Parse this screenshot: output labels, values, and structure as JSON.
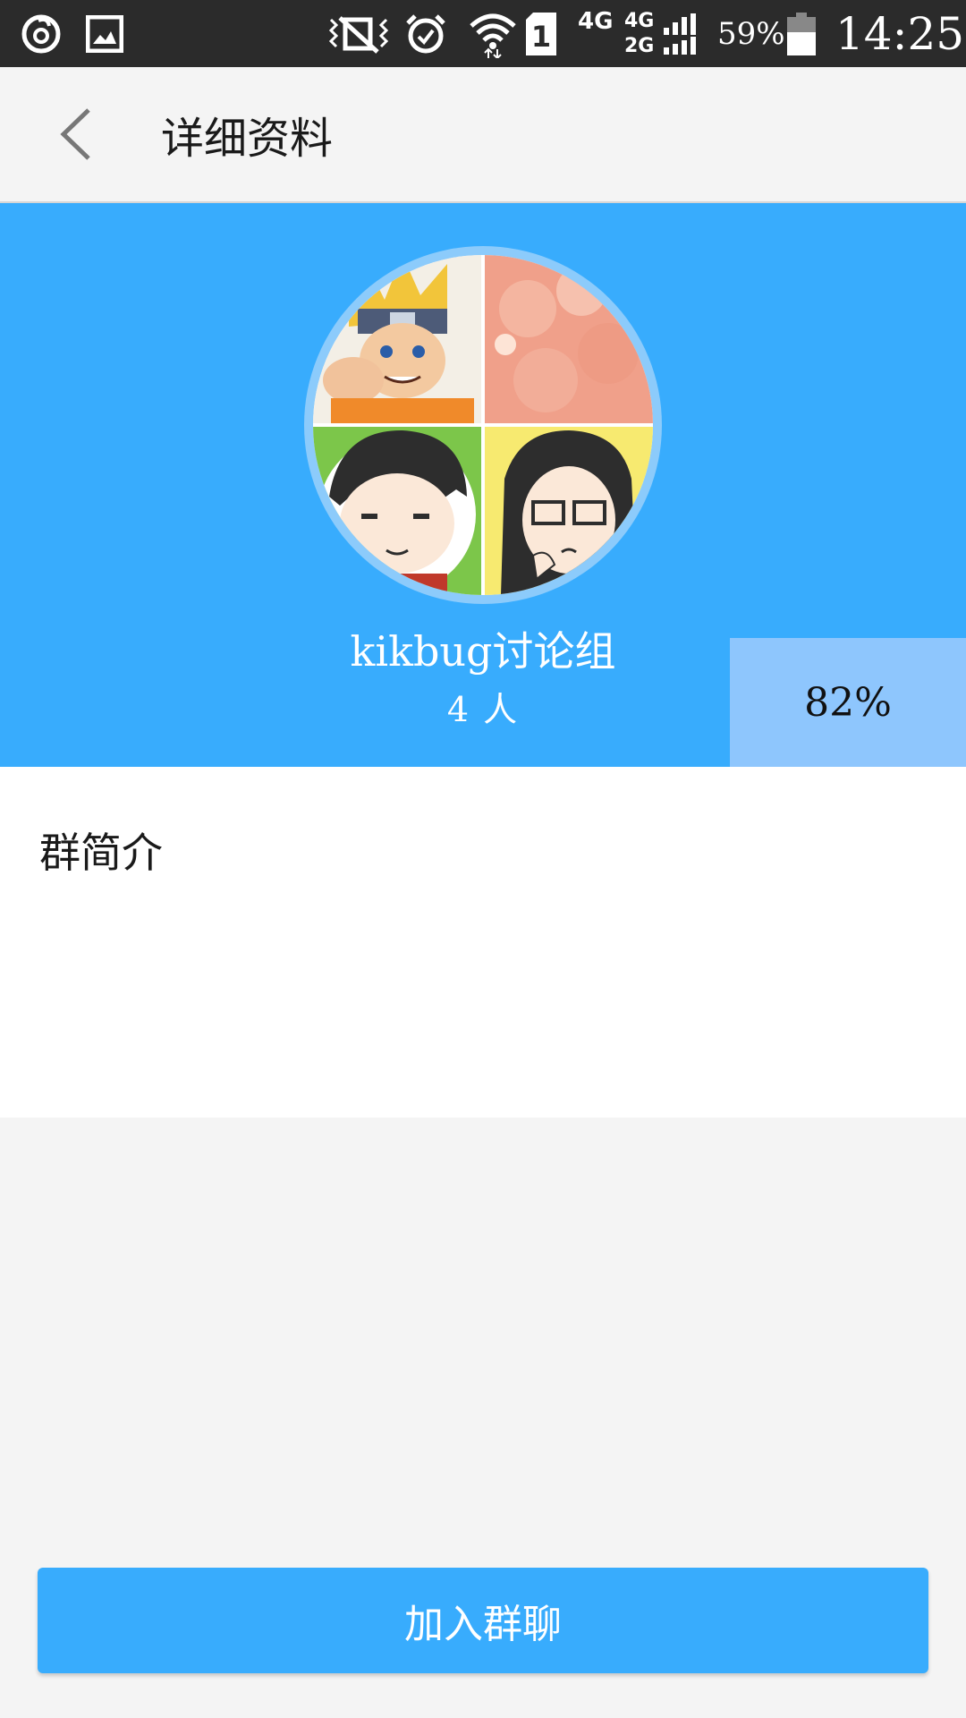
{
  "status_bar": {
    "battery": "59%",
    "time": "14:25",
    "network_1": "4G",
    "network_2": "4G",
    "network_3": "2G",
    "sim_slot": "1",
    "icons": [
      "netease-music-icon",
      "gallery-icon",
      "vibrate-icon",
      "alarm-icon",
      "wifi-icon",
      "sim-icon",
      "signal-icon",
      "battery-icon"
    ]
  },
  "app_bar": {
    "title": "详细资料",
    "back_icon": "chevron-left-icon"
  },
  "group": {
    "name": "kikbug讨论组",
    "members": "4 人",
    "overlay_percent": "82%"
  },
  "intro": {
    "label": "群简介"
  },
  "actions": {
    "join_label": "加入群聊"
  },
  "colors": {
    "primary": "#38acfd",
    "overlay": "#8ec6fd",
    "background": "#f4f4f4",
    "status_bar": "#2b2b2b"
  }
}
